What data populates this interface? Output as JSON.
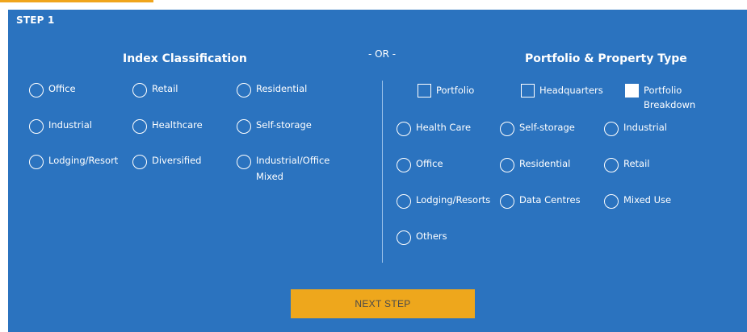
{
  "step_label": "STEP 1",
  "or_label": "- OR -",
  "index_classification": {
    "title": "Index Classification",
    "options": [
      {
        "label": "Office"
      },
      {
        "label": "Retail"
      },
      {
        "label": "Residential"
      },
      {
        "label": "Industrial"
      },
      {
        "label": "Healthcare"
      },
      {
        "label": "Self-storage"
      },
      {
        "label": "Lodging/Resort"
      },
      {
        "label": "Diversified"
      },
      {
        "label": "Industrial/Office",
        "label2": "Mixed"
      }
    ]
  },
  "portfolio_property": {
    "title": "Portfolio & Property Type",
    "checkboxes": [
      {
        "label": "Portfolio"
      },
      {
        "label": "Headquarters"
      },
      {
        "label": "Portfolio",
        "label2": "Breakdown"
      }
    ],
    "options": [
      {
        "label": "Health Care"
      },
      {
        "label": "Self-storage"
      },
      {
        "label": "Industrial"
      },
      {
        "label": "Office"
      },
      {
        "label": "Residential"
      },
      {
        "label": "Retail"
      },
      {
        "label": "Lodging/Resorts"
      },
      {
        "label": "Data Centres"
      },
      {
        "label": "Mixed Use"
      },
      {
        "label": "Others"
      }
    ]
  },
  "next_button": "NEXT STEP",
  "colors": {
    "panel": "#2b73bf",
    "accent": "#eea71c",
    "text": "#ffffff"
  }
}
